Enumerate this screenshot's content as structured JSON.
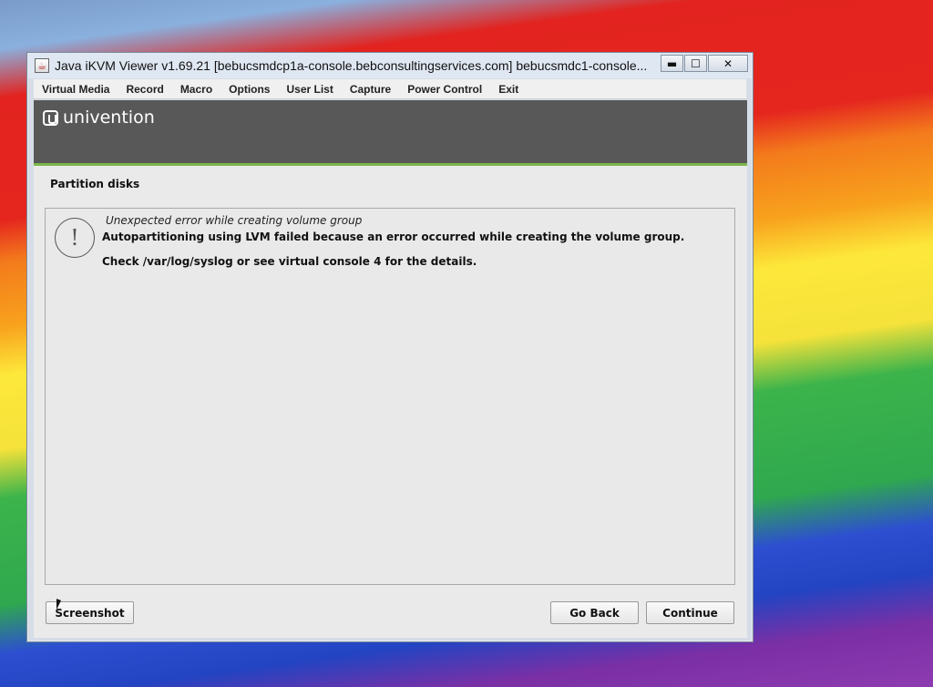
{
  "window": {
    "title": "Java iKVM Viewer v1.69.21 [bebucsmdcp1a-console.bebconsultingservices.com] bebucsmdc1-console...",
    "minimize_glyph": "▬",
    "maximize_glyph": "☐",
    "close_glyph": "✕"
  },
  "menubar": {
    "items": [
      "Virtual Media",
      "Record",
      "Macro",
      "Options",
      "User List",
      "Capture",
      "Power Control",
      "Exit"
    ]
  },
  "installer": {
    "brand": "univention",
    "page_title": "Partition disks",
    "error": {
      "icon": "warning-icon",
      "icon_glyph": "!",
      "heading": "Unexpected error while creating volume group",
      "message": "Autopartitioning using LVM failed because an error occurred while creating the volume group.",
      "detail": "Check /var/log/syslog or see virtual console 4 for the details."
    },
    "buttons": {
      "screenshot": "Screenshot",
      "go_back": "Go Back",
      "continue": "Continue"
    }
  },
  "colors": {
    "banner": "#585858",
    "banner_accent": "#7ab648",
    "titlebar": "#dfe7f2"
  }
}
